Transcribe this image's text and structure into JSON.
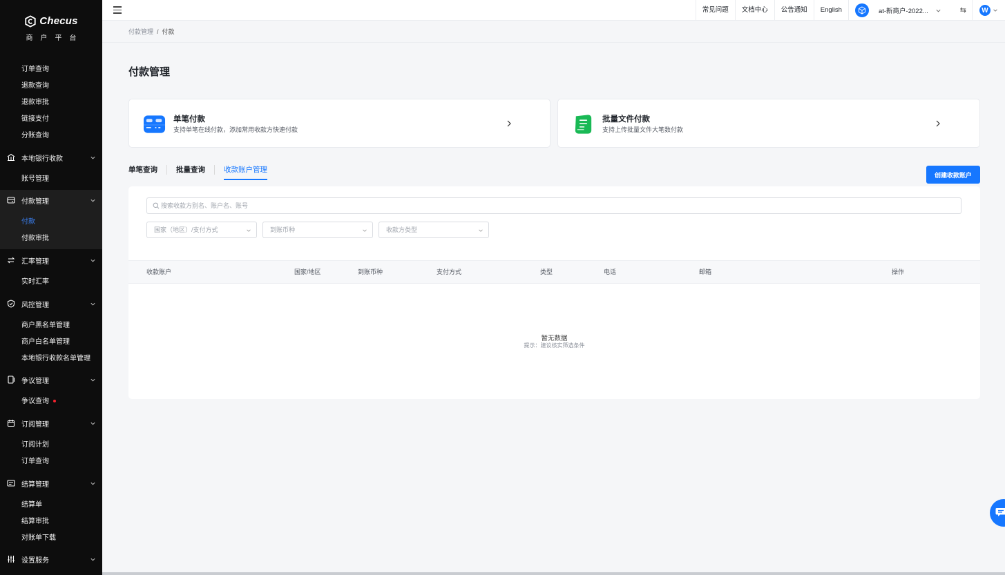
{
  "brand": {
    "name": "Checus",
    "subtitle": "商户平台"
  },
  "sidebar": {
    "top_items": [
      "订单查询",
      "退款查询",
      "退款审批",
      "链接支付",
      "分账查询"
    ],
    "groups": [
      {
        "label": "本地银行收款",
        "icon": "bank-icon",
        "items": [
          {
            "label": "账号管理"
          }
        ]
      },
      {
        "label": "付款管理",
        "icon": "payment-icon",
        "items": [
          {
            "label": "付款",
            "active": true
          },
          {
            "label": "付款审批"
          }
        ]
      },
      {
        "label": "汇率管理",
        "icon": "exchange-icon",
        "items": [
          {
            "label": "实时汇率"
          }
        ]
      },
      {
        "label": "风控管理",
        "icon": "shield-icon",
        "items": [
          {
            "label": "商户黑名单管理"
          },
          {
            "label": "商户白名单管理"
          },
          {
            "label": "本地银行收款名单管理"
          }
        ]
      },
      {
        "label": "争议管理",
        "icon": "dispute-icon",
        "items": [
          {
            "label": "争议查询",
            "badge": true
          }
        ]
      },
      {
        "label": "订阅管理",
        "icon": "calendar-icon",
        "items": [
          {
            "label": "订阅计划"
          },
          {
            "label": "订单查询"
          }
        ]
      },
      {
        "label": "结算管理",
        "icon": "settlement-icon",
        "items": [
          {
            "label": "结算单"
          },
          {
            "label": "结算审批"
          },
          {
            "label": "对账单下载"
          }
        ]
      },
      {
        "label": "设置服务",
        "icon": "settings-sliders-icon",
        "items": []
      }
    ]
  },
  "header": {
    "links": [
      "常见问题",
      "文档中心",
      "公告通知",
      "English"
    ],
    "merchant": "at-新商户-2022...",
    "switch_icon": "⇆",
    "avatar": "W"
  },
  "breadcrumb": {
    "parent": "付款管理",
    "sep": "/",
    "current": "付款"
  },
  "page": {
    "title": "付款管理"
  },
  "cards": [
    {
      "title": "单笔付款",
      "desc": "支持单笔在线付款，添加常用收款方快速付款",
      "icon": "card-payment-icon",
      "color": "#1677ff"
    },
    {
      "title": "批量文件付款",
      "desc": "支持上传批量文件大笔数付款",
      "icon": "batch-file-icon",
      "color": "#19b955"
    }
  ],
  "tabs": [
    {
      "label": "单笔查询",
      "active": false
    },
    {
      "label": "批量查询",
      "active": false
    },
    {
      "label": "收款账户管理",
      "active": true
    }
  ],
  "create_button": "创建收款账户",
  "filters": {
    "search_placeholder": "搜索收款方别名、账户名、账号",
    "selects": [
      "国家（地区）/支付方式",
      "到账币种",
      "收款方类型"
    ]
  },
  "table": {
    "columns": [
      "收款账户",
      "国家/地区",
      "到账币种",
      "支付方式",
      "类型",
      "电话",
      "邮箱",
      "操作"
    ],
    "rows": []
  },
  "empty": {
    "title": "暂无数据",
    "hint": "提示：建议核实筛选条件"
  },
  "colors": {
    "accent": "#1677ff",
    "sidebar_bg": "#0d0d0d",
    "badge": "#f5222d"
  }
}
